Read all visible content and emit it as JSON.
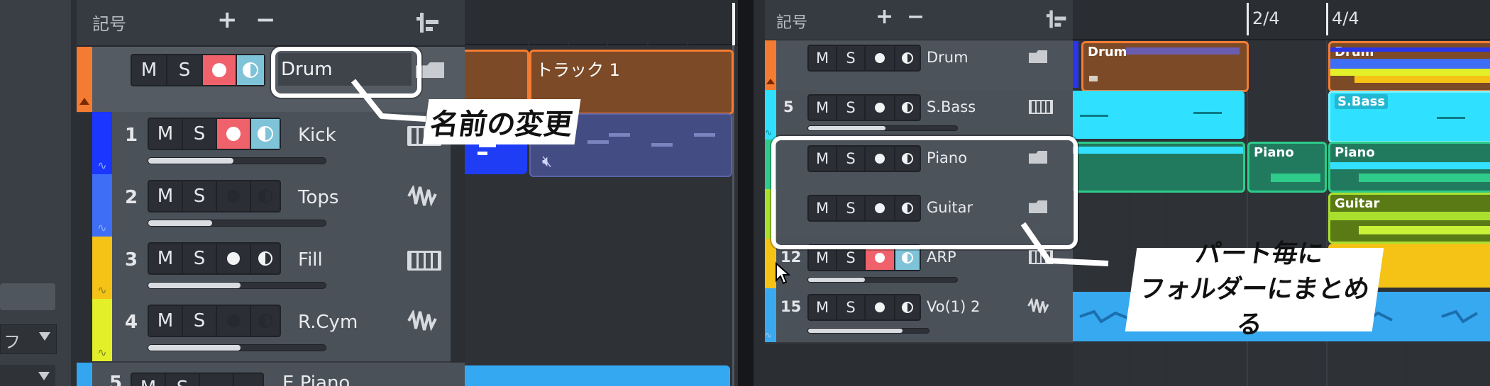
{
  "left": {
    "header": {
      "title": "記号",
      "add_label": "+",
      "remove_label": "−"
    },
    "folder_track": {
      "name": "Drum",
      "m": "M",
      "s": "S",
      "color": "#f47c32"
    },
    "clip_track_label": "トラック 1",
    "tracks": [
      {
        "num": "1",
        "name": "Kick",
        "m": "M",
        "s": "S",
        "color": "#1b36ff",
        "rec": true,
        "mon": true,
        "fader": 0.48,
        "icon": "piano-icon"
      },
      {
        "num": "2",
        "name": "Tops",
        "m": "M",
        "s": "S",
        "color": "#3d6ef5",
        "rec": false,
        "mon": false,
        "fader": 0.36,
        "icon": "waveform-icon"
      },
      {
        "num": "3",
        "name": "Fill",
        "m": "M",
        "s": "S",
        "color": "#f5c316",
        "rec": false,
        "mon": false,
        "fader": 0.52,
        "icon": "piano-icon"
      },
      {
        "num": "4",
        "name": "R.Cym",
        "m": "M",
        "s": "S",
        "color": "#e3ef28",
        "rec": false,
        "mon": false,
        "fader": 0.52,
        "icon": "waveform-icon"
      },
      {
        "num": "5",
        "name": "E.Piano",
        "m": "M",
        "s": "S",
        "color": "#33a6ef"
      }
    ],
    "annotation": "名前の変更",
    "side_panel_text": "フ"
  },
  "right": {
    "header": {
      "title": "記号",
      "add_label": "+",
      "remove_label": "−"
    },
    "ruler": {
      "bar1": "2/4",
      "bar2": "4/4"
    },
    "tracks": [
      {
        "num": "",
        "name": "Drum",
        "m": "M",
        "s": "S",
        "color": "#f47c32",
        "icon": "folder-icon"
      },
      {
        "num": "5",
        "name": "S.Bass",
        "m": "M",
        "s": "S",
        "color": "#30e0ff",
        "icon": "piano-icon",
        "fader": 0.52
      },
      {
        "num": "",
        "name": "Piano",
        "m": "M",
        "s": "S",
        "color": "#2ecb8a",
        "icon": "folder-icon"
      },
      {
        "num": "",
        "name": "Guitar",
        "m": "M",
        "s": "S",
        "color": "#a9e02e",
        "icon": "folder-icon"
      },
      {
        "num": "12",
        "name": "ARP",
        "m": "M",
        "s": "S",
        "color": "#f5c316",
        "icon": "piano-icon",
        "rec": true,
        "mon": true,
        "fader": 0.38
      },
      {
        "num": "15",
        "name": "Vo(1) 2",
        "m": "M",
        "s": "S",
        "color": "#3aa9f0",
        "icon": "waveform-icon",
        "fader": 0.78
      }
    ],
    "clips": {
      "drum": "Drum",
      "drum2": "Drum",
      "sbass": "S.Bass",
      "piano": "Piano",
      "piano2": "Piano",
      "guitar": "Guitar"
    },
    "annotation_line1": "パート毎に",
    "annotation_line2": "フォルダーにまとめる"
  }
}
